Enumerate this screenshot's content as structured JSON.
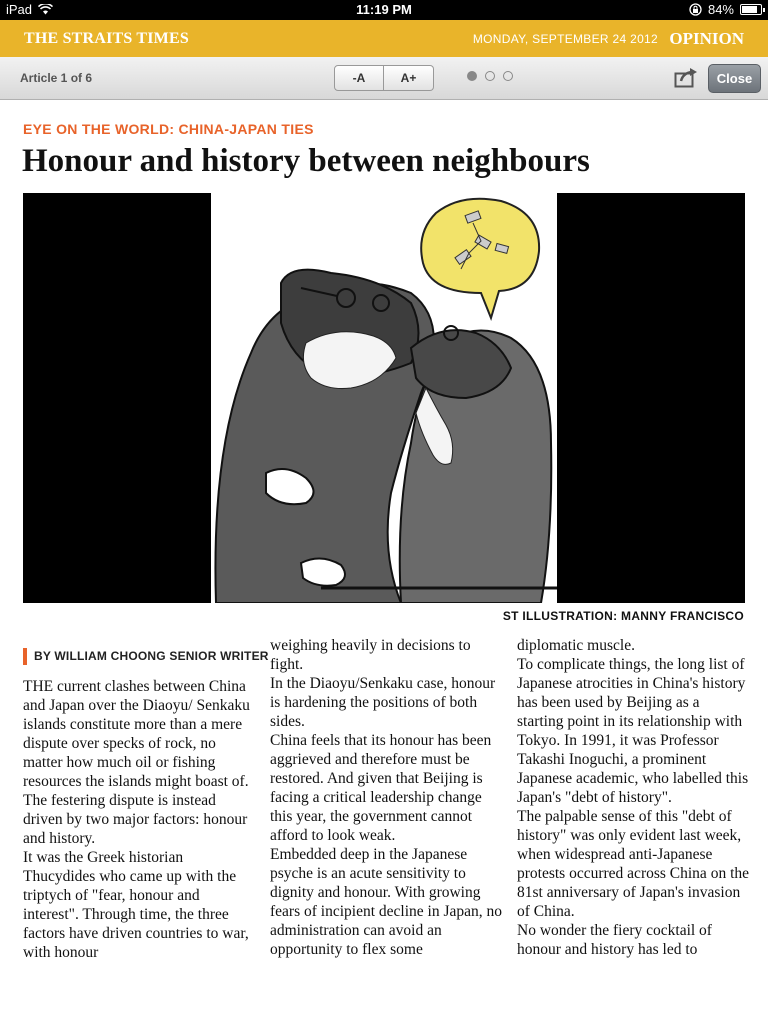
{
  "status_bar": {
    "device": "iPad",
    "time": "11:19 PM",
    "battery": "84%",
    "battery_level": 0.84
  },
  "masthead": {
    "logo": "THE STRAITS TIMES",
    "date": "MONDAY, SEPTEMBER 24 2012",
    "section": "OPINION"
  },
  "toolbar": {
    "article_counter": "Article 1 of 6",
    "font_decrease": "-A",
    "font_increase": "A+",
    "page_dots": 3,
    "active_dot": 1,
    "close_label": "Close"
  },
  "article": {
    "kicker": "EYE ON THE WORLD: CHINA-JAPAN TIES",
    "headline": "Honour and history between neighbours",
    "image_credit": "ST ILLUSTRATION: MANNY FRANCISCO",
    "byline": "BY WILLIAM CHOONG SENIOR WRITER",
    "columns": [
      [
        "THE current clashes between China and Japan over the Diaoyu/ Senkaku islands constitute more than a mere dispute over specks of rock, no matter how much oil or fishing resources the islands might boast of.",
        " The festering dispute is instead driven by two major factors: honour and history.",
        " It was the Greek historian Thucydides who came up with the triptych of \"fear, honour and interest\". Through time, the three factors have driven countries to war, with honour"
      ],
      [
        "weighing heavily in decisions to fight.",
        " In the Diaoyu/Senkaku case, honour is hardening the positions of both sides.",
        " China feels that its honour has been aggrieved and therefore must be restored. And given that Beijing is facing a critical leadership change this year, the government cannot afford to look weak.",
        " Embedded deep in the Japanese psyche is an acute sensitivity to dignity and honour. With growing fears of incipient decline in Japan, no administration can avoid an opportunity to flex some"
      ],
      [
        "diplomatic muscle.",
        " To complicate things, the long list of Japanese atrocities in China's history has been used by Beijing as a starting point in its relationship with Tokyo. In 1991, it was Professor Takashi Inoguchi, a prominent Japanese academic, who labelled this Japan's \"debt of history\".",
        " The palpable sense of this \"debt of history\" was only evident last week, when widespread anti-Japanese protests occurred across China on the 81st anniversary of Japan's invasion of China.",
        " No wonder the fiery cocktail of honour and history has led to"
      ]
    ]
  },
  "colors": {
    "masthead": "#e9b42a",
    "kicker": "#e8632a",
    "close_button": "#7d838a"
  },
  "icons": [
    "wifi-icon",
    "lock-rotation-icon",
    "battery-icon",
    "share-icon"
  ]
}
